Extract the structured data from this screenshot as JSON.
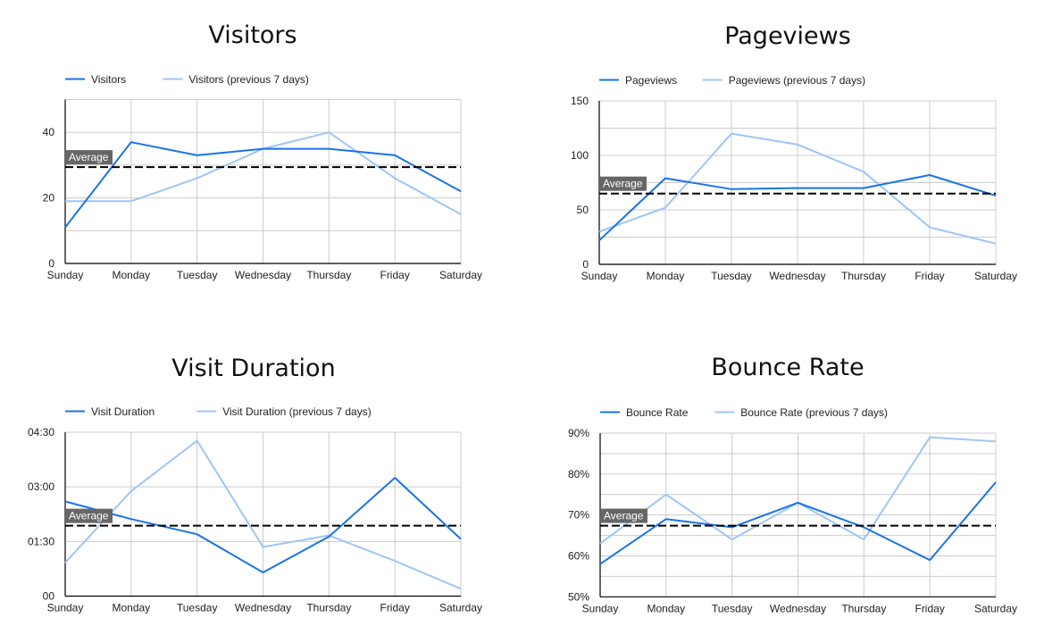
{
  "colors": {
    "current": "#1a73e8",
    "previous": "#9fc5f8",
    "average": "#000000",
    "grid": "#cccccc",
    "average_label_bg": "#666666"
  },
  "chart_data": [
    {
      "type": "line",
      "title": "Visitors",
      "categories": [
        "Sunday",
        "Monday",
        "Tuesday",
        "Wednesday",
        "Thursday",
        "Friday",
        "Saturday"
      ],
      "series": [
        {
          "name": "Visitors",
          "values": [
            11,
            37,
            33,
            35,
            35,
            33,
            22
          ]
        },
        {
          "name": "Visitors (previous 7 days)",
          "values": [
            19,
            19,
            26,
            35,
            40,
            26,
            15
          ]
        }
      ],
      "average": {
        "label": "Average",
        "value": 29.4
      },
      "ylim": [
        0,
        50
      ],
      "grid_step": 10,
      "yticks": [
        {
          "value": 0,
          "label": "0"
        },
        {
          "value": 20,
          "label": "20"
        },
        {
          "value": 40,
          "label": "40"
        }
      ],
      "xlabel": "",
      "ylabel": "",
      "grid": true,
      "legend": "top-left"
    },
    {
      "type": "line",
      "title": "Pageviews",
      "categories": [
        "Sunday",
        "Monday",
        "Tuesday",
        "Wednesday",
        "Thursday",
        "Friday",
        "Saturday"
      ],
      "series": [
        {
          "name": "Pageviews",
          "values": [
            22,
            79,
            69,
            70,
            70,
            82,
            63
          ]
        },
        {
          "name": "Pageviews (previous 7 days)",
          "values": [
            30,
            52,
            120,
            110,
            85,
            34,
            19
          ]
        }
      ],
      "average": {
        "label": "Average",
        "value": 65
      },
      "ylim": [
        0,
        150
      ],
      "grid_step": 25,
      "yticks": [
        {
          "value": 0,
          "label": "0"
        },
        {
          "value": 50,
          "label": "50"
        },
        {
          "value": 100,
          "label": "100"
        },
        {
          "value": 150,
          "label": "150"
        }
      ],
      "xlabel": "",
      "ylabel": "",
      "grid": true,
      "legend": "top-left"
    },
    {
      "type": "line",
      "title": "Visit Duration",
      "unit": "seconds",
      "categories": [
        "Sunday",
        "Monday",
        "Tuesday",
        "Wednesday",
        "Thursday",
        "Friday",
        "Saturday"
      ],
      "series": [
        {
          "name": "Visit Duration",
          "values": [
            156,
            127,
            102,
            39,
            98,
            195,
            94
          ]
        },
        {
          "name": "Visit Duration (previous 7 days)",
          "values": [
            55,
            173,
            256,
            81,
            100,
            58,
            12
          ]
        }
      ],
      "average": {
        "label": "Average",
        "value": 116
      },
      "ylim": [
        0,
        270
      ],
      "grid_step": 90,
      "yticks": [
        {
          "value": 0,
          "label": "00"
        },
        {
          "value": 90,
          "label": "01:30"
        },
        {
          "value": 180,
          "label": "03:00"
        },
        {
          "value": 270,
          "label": "04:30"
        }
      ],
      "xlabel": "",
      "ylabel": "",
      "grid": true,
      "legend": "top-left"
    },
    {
      "type": "line",
      "title": "Bounce Rate",
      "unit": "percent",
      "categories": [
        "Sunday",
        "Monday",
        "Tuesday",
        "Wednesday",
        "Thursday",
        "Friday",
        "Saturday"
      ],
      "series": [
        {
          "name": "Bounce Rate",
          "values": [
            58,
            69,
            67,
            73,
            67,
            59,
            78
          ]
        },
        {
          "name": "Bounce Rate (previous 7 days)",
          "values": [
            63,
            75,
            64,
            73,
            64,
            89,
            88
          ]
        }
      ],
      "average": {
        "label": "Average",
        "value": 67.4
      },
      "ylim": [
        50,
        90
      ],
      "grid_step": 5,
      "yticks": [
        {
          "value": 50,
          "label": "50%"
        },
        {
          "value": 60,
          "label": "60%"
        },
        {
          "value": 70,
          "label": "70%"
        },
        {
          "value": 80,
          "label": "80%"
        },
        {
          "value": 90,
          "label": "90%"
        }
      ],
      "xlabel": "",
      "ylabel": "",
      "grid": true,
      "legend": "top-left"
    }
  ]
}
